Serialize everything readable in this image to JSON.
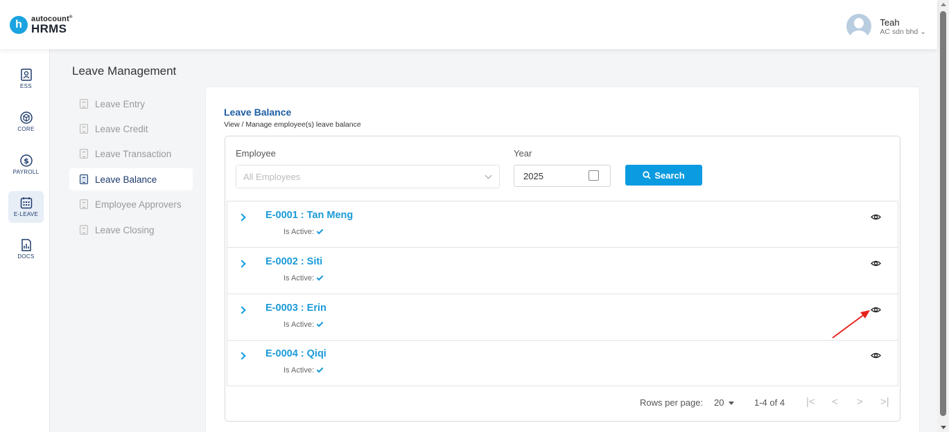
{
  "brand": {
    "logo_letter": "h",
    "name_small": "autocount",
    "mark": "®",
    "name_big": "HRMS",
    "accent": "#0b9be0"
  },
  "user": {
    "name": "Teah",
    "company": "AC sdn bhd ⌄"
  },
  "rail": [
    {
      "label": "ESS",
      "icon": "ess-icon"
    },
    {
      "label": "CORE",
      "icon": "cube-icon"
    },
    {
      "label": "PAYROLL",
      "icon": "dollar-icon"
    },
    {
      "label": "E-LEAVE",
      "icon": "calendar-icon"
    },
    {
      "label": "DOCS",
      "icon": "docs-icon"
    }
  ],
  "section_title": "Leave Management",
  "subnav": [
    {
      "label": "Leave Entry"
    },
    {
      "label": "Leave Credit"
    },
    {
      "label": "Leave Transaction"
    },
    {
      "label": "Leave Balance"
    },
    {
      "label": "Employee Approvers"
    },
    {
      "label": "Leave Closing"
    }
  ],
  "card": {
    "title": "Leave Balance",
    "subtitle": "View / Manage employee(s) leave balance"
  },
  "filters": {
    "employee_label": "Employee",
    "employee_placeholder": "All Employees",
    "year_label": "Year",
    "year_value": "2025",
    "search_label": "Search"
  },
  "employees": [
    {
      "name": "E-0001 : Tan Meng",
      "active_label": "Is Active:"
    },
    {
      "name": "E-0002 : Siti",
      "active_label": "Is Active:"
    },
    {
      "name": "E-0003 : Erin",
      "active_label": "Is Active:"
    },
    {
      "name": "E-0004 : Qiqi",
      "active_label": "Is Active:"
    }
  ],
  "pagination": {
    "rows_per_page_label": "Rows per page:",
    "rows_per_page_value": "20",
    "range": "1-4 of 4",
    "first": "|<",
    "prev": "<",
    "next": ">",
    "last": ">|"
  }
}
